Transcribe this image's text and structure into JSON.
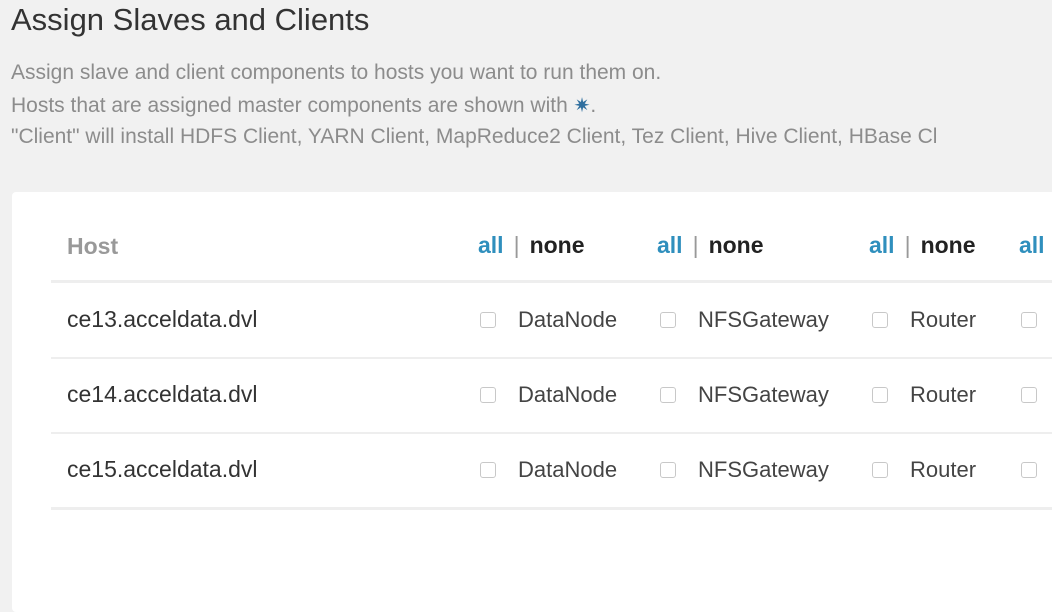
{
  "page": {
    "title": "Assign Slaves and Clients",
    "description_line1": "Assign slave and client components to hosts you want to run them on.",
    "description_line2": "Hosts that are assigned master components are shown with ",
    "master_marker_icon": "asterisk-icon",
    "master_marker_glyph": "✷",
    "description_line2_end": ".",
    "description_line3": "\"Client\" will install HDFS Client, YARN Client, MapReduce2 Client, Tez Client, Hive Client, HBase Cl"
  },
  "table": {
    "host_header": "Host",
    "column_groups": [
      {
        "all_label": "all",
        "separator": "|",
        "none_label": "none",
        "component": "DataNode"
      },
      {
        "all_label": "all",
        "separator": "|",
        "none_label": "none",
        "component": "NFSGateway"
      },
      {
        "all_label": "all",
        "separator": "|",
        "none_label": "none",
        "component": "Router"
      },
      {
        "all_label": "all"
      }
    ],
    "rows": [
      {
        "host": "ce13.acceldata.dvl",
        "components": [
          "DataNode",
          "NFSGateway",
          "Router"
        ],
        "checked": [
          false,
          false,
          false,
          false
        ]
      },
      {
        "host": "ce14.acceldata.dvl",
        "components": [
          "DataNode",
          "NFSGateway",
          "Router"
        ],
        "checked": [
          false,
          false,
          false,
          false
        ]
      },
      {
        "host": "ce15.acceldata.dvl",
        "components": [
          "DataNode",
          "NFSGateway",
          "Router"
        ],
        "checked": [
          false,
          false,
          false,
          false
        ]
      }
    ]
  },
  "colors": {
    "link_blue": "#2f8fbd",
    "master_marker": "#2f6f9f",
    "background": "#f1f1f1",
    "panel": "#ffffff"
  }
}
